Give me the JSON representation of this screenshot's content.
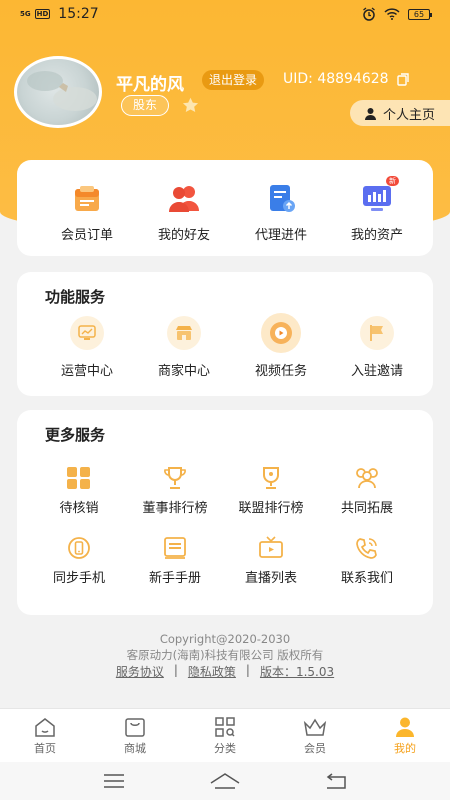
{
  "status_bar": {
    "signal_top": "5G",
    "signal_hd": "HD",
    "time": "15:27",
    "battery": "65",
    "icons": [
      "alarm-icon",
      "wifi-icon",
      "battery-icon"
    ]
  },
  "profile": {
    "username": "平凡的风",
    "logout_label": "退出登录",
    "uid": "UID: 48894628",
    "role": "股东",
    "profile_button": "个人主页"
  },
  "quick_actions": [
    {
      "label": "会员订单",
      "icon": "clipboard-icon"
    },
    {
      "label": "我的好友",
      "icon": "friends-icon"
    },
    {
      "label": "代理进件",
      "icon": "document-upload-icon"
    },
    {
      "label": "我的资产",
      "icon": "assets-chart-icon",
      "badge": "新"
    }
  ],
  "functions": {
    "title": "功能服务",
    "items": [
      {
        "label": "运营中心",
        "icon": "operations-icon"
      },
      {
        "label": "商家中心",
        "icon": "store-icon"
      },
      {
        "label": "视频任务",
        "icon": "video-play-icon"
      },
      {
        "label": "入驻邀请",
        "icon": "flag-invite-icon"
      }
    ]
  },
  "more_services": {
    "title": "更多服务",
    "items": [
      {
        "label": "待核销",
        "icon": "grid-icon"
      },
      {
        "label": "董事排行榜",
        "icon": "trophy-icon"
      },
      {
        "label": "联盟排行榜",
        "icon": "cup-icon"
      },
      {
        "label": "共同拓展",
        "icon": "group-icon"
      },
      {
        "label": "同步手机",
        "icon": "phone-sync-icon"
      },
      {
        "label": "新手手册",
        "icon": "manual-icon"
      },
      {
        "label": "直播列表",
        "icon": "tv-live-icon"
      },
      {
        "label": "联系我们",
        "icon": "phone-call-icon"
      }
    ]
  },
  "footer": {
    "copyright": "Copyright@2020-2030",
    "company": "客原动力(海南)科技有限公司 版权所有",
    "links": [
      "服务协议",
      "隐私政策",
      "版本：1.5.03"
    ],
    "separator": "|"
  },
  "tabs": [
    {
      "label": "首页",
      "icon": "home-icon",
      "active": false
    },
    {
      "label": "商城",
      "icon": "shop-bag-icon",
      "active": false
    },
    {
      "label": "分类",
      "icon": "category-icon",
      "active": false
    },
    {
      "label": "会员",
      "icon": "crown-icon",
      "active": false
    },
    {
      "label": "我的",
      "icon": "user-icon",
      "active": true
    }
  ],
  "colors": {
    "brand": "#fcb733",
    "accent": "#f5a11b",
    "logout_bg": "#e99a12",
    "badge_red": "#f24a3a"
  }
}
